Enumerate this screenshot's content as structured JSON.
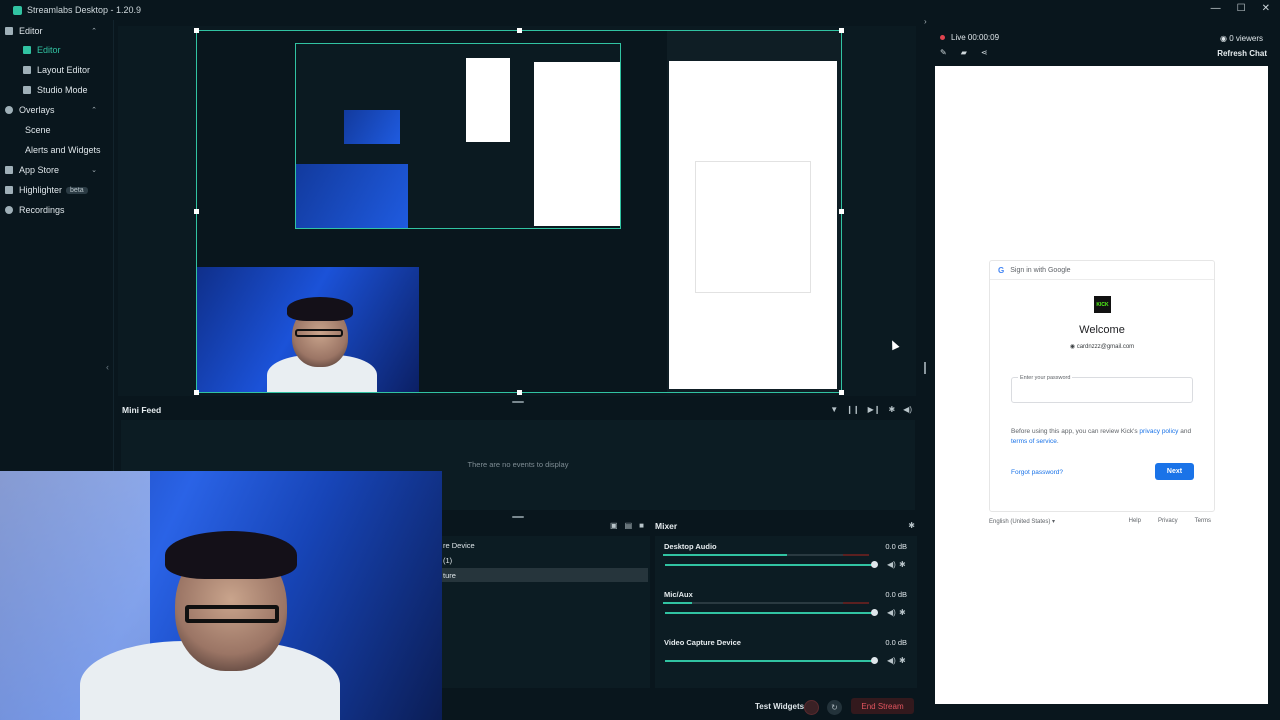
{
  "window": {
    "title": "Streamlabs Desktop - 1.20.9",
    "controls": [
      "—",
      "☐",
      "✕"
    ]
  },
  "sidebar": {
    "items": [
      {
        "label": "Editor",
        "icon": "editor-icon",
        "chevron": "⌃"
      },
      {
        "label": "Editor",
        "icon": "editor-icon",
        "active": true
      },
      {
        "label": "Layout Editor",
        "icon": "layout-editor-icon"
      },
      {
        "label": "Studio Mode",
        "icon": "studio-mode-icon"
      },
      {
        "label": "Overlays",
        "icon": "overlays-icon",
        "chevron": "⌃"
      },
      {
        "label": "Scene"
      },
      {
        "label": "Alerts and Widgets"
      },
      {
        "label": "App Store",
        "icon": "app-store-icon",
        "chevron": "⌄"
      },
      {
        "label": "Highlighter",
        "icon": "highlighter-icon",
        "badge": "beta"
      },
      {
        "label": "Recordings",
        "icon": "recordings-icon"
      }
    ]
  },
  "mini_feed": {
    "title": "Mini Feed",
    "empty_text": "There are no events to display"
  },
  "sources": {
    "items": [
      "re Device",
      "(1)",
      "ture"
    ]
  },
  "mixer": {
    "title": "Mixer",
    "tracks": [
      {
        "name": "Desktop Audio",
        "db": "0.0 dB",
        "level": 0.6
      },
      {
        "name": "Mic/Aux",
        "db": "0.0 dB",
        "level": 0.14
      },
      {
        "name": "Video Capture Device",
        "db": "0.0 dB",
        "level": 0.0
      }
    ]
  },
  "footer": {
    "test_widgets": "Test Widgets",
    "end_stream": "End Stream"
  },
  "chat": {
    "live_time": "Live 00:00:09",
    "viewers": "0 viewers",
    "refresh": "Refresh Chat"
  },
  "google_signin": {
    "header": "Sign in with Google",
    "logo_text": "KICK",
    "welcome": "Welcome",
    "email": "cardnzzz@gmail.com",
    "password_label": "Enter your password",
    "review_prefix": "Before using this app, you can review Kick's ",
    "privacy_link": "privacy policy",
    "review_mid": " and ",
    "terms_link": "terms of service",
    "review_suffix": ".",
    "forgot": "Forgot password?",
    "next": "Next",
    "language": "English (United States)",
    "footer_links": [
      "Help",
      "Privacy",
      "Terms"
    ]
  },
  "colors": {
    "accent": "#31c3a2",
    "background": "#09161d",
    "end_stream": "#e0545e",
    "google_blue": "#1a73e8"
  }
}
